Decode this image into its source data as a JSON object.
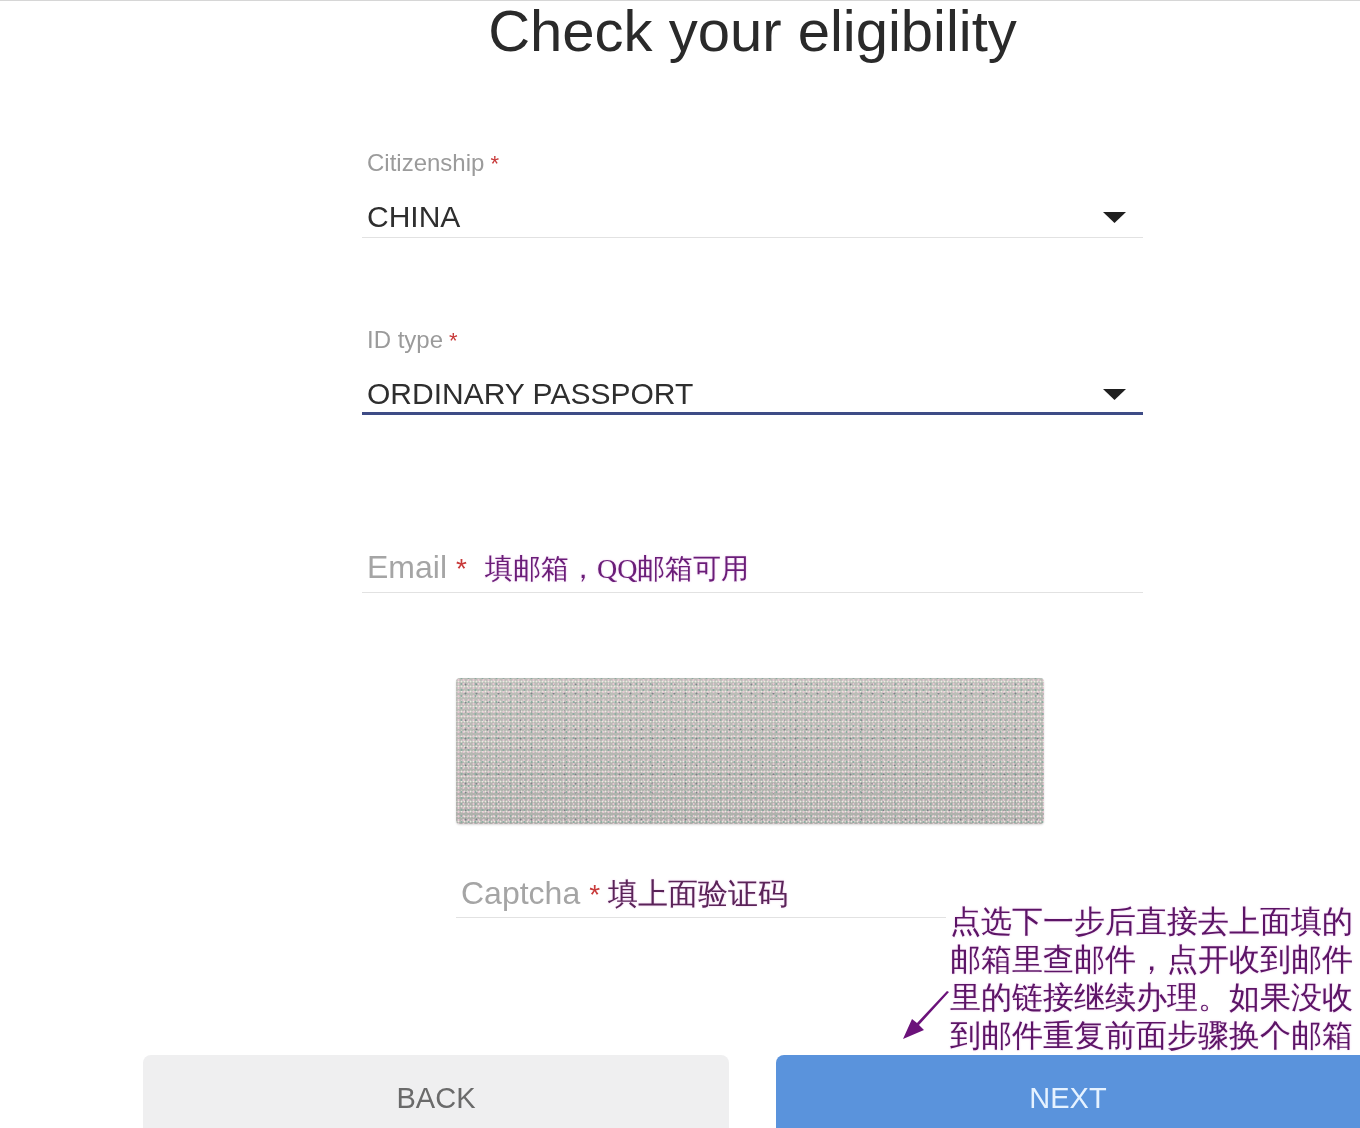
{
  "page": {
    "title": "Check your eligibility"
  },
  "fields": [
    {
      "kind": "select",
      "label": "Citizenship",
      "required_mark": "*",
      "value": "CHINA",
      "focused": false
    },
    {
      "kind": "select",
      "label": "ID type",
      "required_mark": "*",
      "value": "ORDINARY PASSPORT",
      "focused": true
    },
    {
      "kind": "text",
      "label": "Email",
      "required_mark": "*",
      "note": "填邮箱，QQ邮箱可用",
      "focused": false
    },
    {
      "kind": "captcha_image"
    },
    {
      "kind": "text",
      "label": "Captcha",
      "required_mark": "*",
      "note": "填上面验证码",
      "focused": false
    }
  ],
  "annotation": {
    "text": "点选下一步后直接去上面填的邮箱里查邮件，点开收到邮件里的链接继续办理。如果没收到邮件重复前面步骤换个邮箱"
  },
  "buttons": [
    {
      "kind": "back",
      "label": "BACK"
    },
    {
      "kind": "next",
      "label": "NEXT"
    }
  ]
}
